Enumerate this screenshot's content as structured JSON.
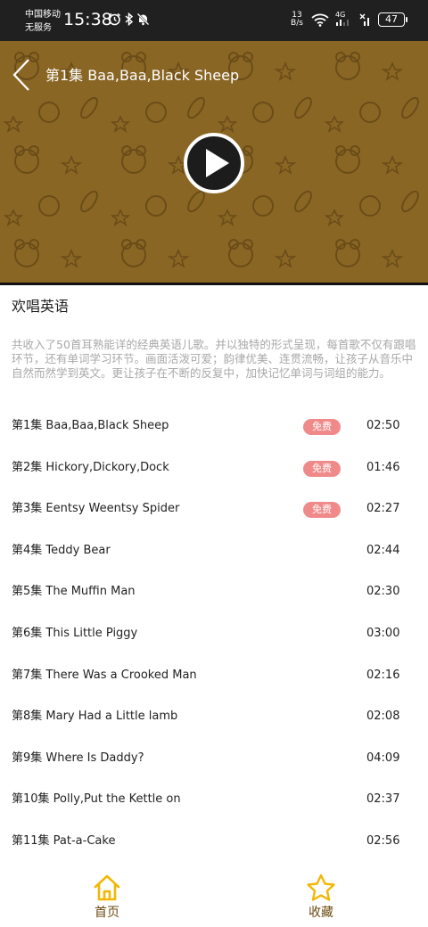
{
  "status_bar": {
    "carrier_line1": "中国移动",
    "carrier_line2": "无服务",
    "time": "15:38",
    "net_speed_value": "13",
    "net_speed_unit": "B/s",
    "signal_label": "4G",
    "battery": "47"
  },
  "player": {
    "title": "第1集 Baa,Baa,Black Sheep",
    "background_color": "#8a6624",
    "back_icon": "chevron-left-icon",
    "play_icon": "play-icon"
  },
  "album": {
    "title": "欢唱英语",
    "description": "共收入了50首耳熟能详的经典英语儿歌。并以独特的形式呈现，每首歌不仅有跟唱环节，还有单词学习环节。画面活泼可爱；韵律优美、连贯流畅，让孩子从音乐中自然而然学到英文。更让孩子在不断的反复中，加快记忆单词与词组的能力。"
  },
  "episodes": [
    {
      "title": "第1集 Baa,Baa,Black Sheep",
      "badge": "免费",
      "duration": "02:50"
    },
    {
      "title": "第2集 Hickory,Dickory,Dock",
      "badge": "免费",
      "duration": "01:46"
    },
    {
      "title": "第3集 Eentsy Weentsy Spider",
      "badge": "免费",
      "duration": "02:27"
    },
    {
      "title": "第4集 Teddy Bear",
      "badge": "",
      "duration": "02:44"
    },
    {
      "title": "第5集 The Muffin Man",
      "badge": "",
      "duration": "02:30"
    },
    {
      "title": "第6集 This Little Piggy",
      "badge": "",
      "duration": "03:00"
    },
    {
      "title": "第7集 There Was a Crooked Man",
      "badge": "",
      "duration": "02:16"
    },
    {
      "title": "第8集 Mary Had a Little lamb",
      "badge": "",
      "duration": "02:08"
    },
    {
      "title": "第9集 Where Is Daddy?",
      "badge": "",
      "duration": "04:09"
    },
    {
      "title": "第10集 Polly,Put the Kettle on",
      "badge": "",
      "duration": "02:37"
    },
    {
      "title": "第11集 Pat-a-Cake",
      "badge": "",
      "duration": "02:56"
    }
  ],
  "bottom_nav": {
    "home_label": "首页",
    "favorites_label": "收藏",
    "accent_color": "#f2b705"
  }
}
